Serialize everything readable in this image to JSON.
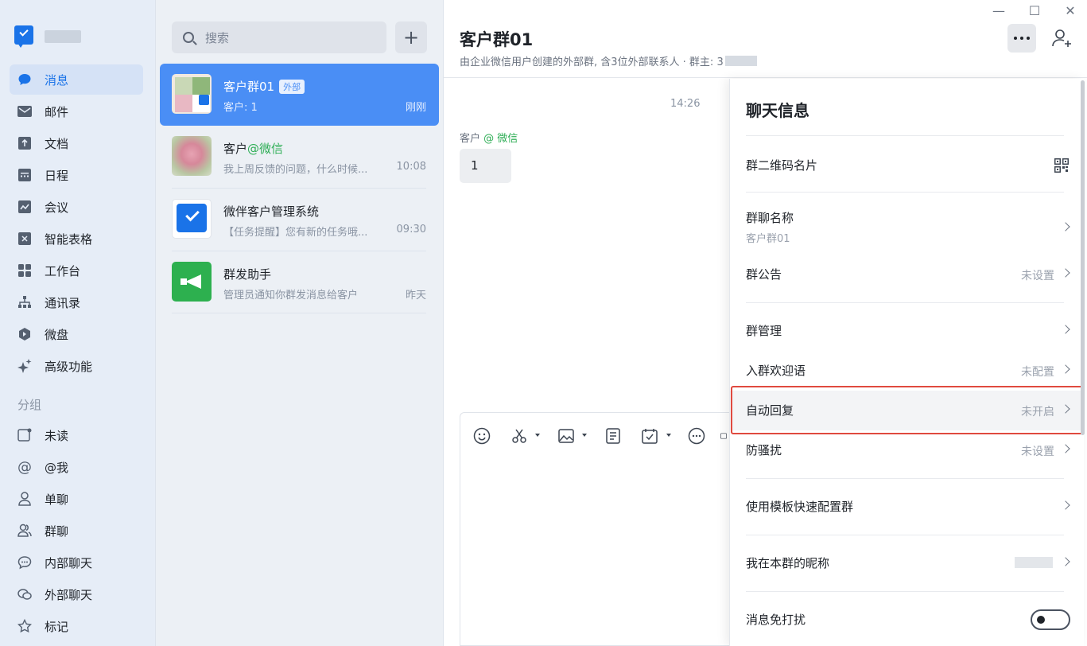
{
  "nav": {
    "items": [
      {
        "label": "消息",
        "icon": "chat-bubble-icon"
      },
      {
        "label": "邮件",
        "icon": "mail-icon"
      },
      {
        "label": "文档",
        "icon": "doc-icon"
      },
      {
        "label": "日程",
        "icon": "calendar-icon"
      },
      {
        "label": "会议",
        "icon": "meeting-icon"
      },
      {
        "label": "智能表格",
        "icon": "smart-sheet-icon"
      },
      {
        "label": "工作台",
        "icon": "workbench-icon"
      },
      {
        "label": "通讯录",
        "icon": "contacts-icon"
      },
      {
        "label": "微盘",
        "icon": "drive-icon"
      },
      {
        "label": "高级功能",
        "icon": "sparkle-icon"
      }
    ],
    "section_label": "分组",
    "groups": [
      {
        "label": "未读",
        "icon": "unread-icon"
      },
      {
        "label": "@我",
        "icon": "at-icon"
      },
      {
        "label": "单聊",
        "icon": "person-icon"
      },
      {
        "label": "群聊",
        "icon": "group-icon"
      },
      {
        "label": "内部聊天",
        "icon": "internal-chat-icon"
      },
      {
        "label": "外部聊天",
        "icon": "external-chat-icon"
      },
      {
        "label": "标记",
        "icon": "star-icon"
      }
    ]
  },
  "list": {
    "search_placeholder": "搜索",
    "conversations": [
      {
        "name": "客户群01",
        "tag": "外部",
        "preview": "客户: 1",
        "time": "刚刚"
      },
      {
        "name": "客户",
        "name_suffix": "@微信",
        "preview": "我上周反馈的问题，什么时候...",
        "time": "10:08"
      },
      {
        "name": "微伴客户管理系统",
        "preview": "【任务提醒】您有新的任务哦...",
        "time": "09:30"
      },
      {
        "name": "群发助手",
        "preview": "管理员通知你群发消息给客户",
        "time": "昨天"
      }
    ]
  },
  "chat": {
    "title": "客户群01",
    "subtitle": "由企业微信用户创建的外部群, 含3位外部联系人 · 群主: 3",
    "time": "14:26",
    "sender": "客户",
    "sender_suffix": "@ 微信",
    "message": "1"
  },
  "info": {
    "title": "聊天信息",
    "rows": {
      "qr": {
        "label": "群二维码名片"
      },
      "name": {
        "label": "群聊名称",
        "value": "客户群01"
      },
      "notice": {
        "label": "群公告",
        "value": "未设置"
      },
      "manage": {
        "label": "群管理"
      },
      "welcome": {
        "label": "入群欢迎语",
        "value": "未配置"
      },
      "autoreply": {
        "label": "自动回复",
        "value": "未开启"
      },
      "antispam": {
        "label": "防骚扰",
        "value": "未设置"
      },
      "template": {
        "label": "使用模板快速配置群"
      },
      "nickname": {
        "label": "我在本群的昵称"
      },
      "mute": {
        "label": "消息免打扰",
        "enabled": false
      }
    }
  },
  "colors": {
    "accent": "#4a8ef5",
    "highlight": "#e04a3f",
    "green": "#2fae56"
  }
}
